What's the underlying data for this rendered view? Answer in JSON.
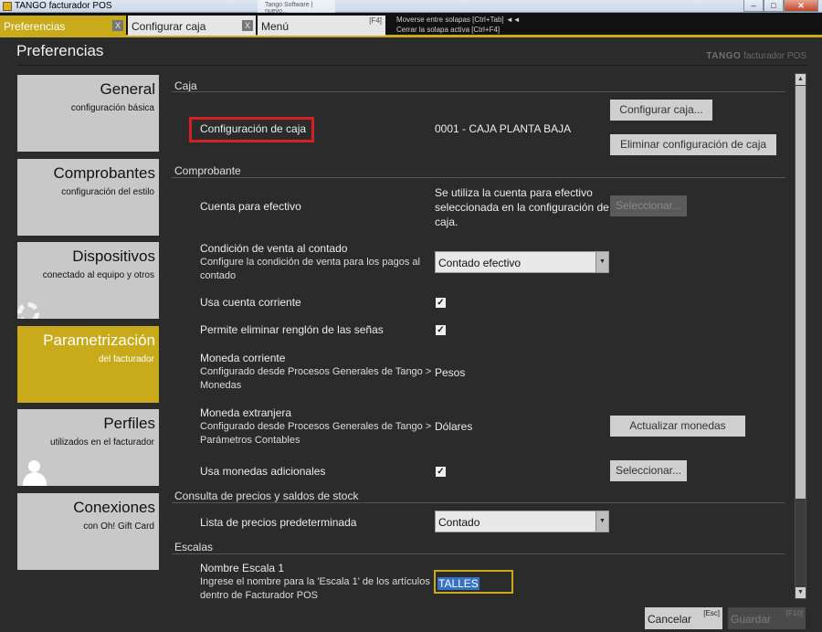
{
  "window": {
    "title": "TANGO facturador POS",
    "ghost_tab": "Tango Software | nuevo..."
  },
  "tabs": [
    {
      "label": "Preferencias",
      "close": "X"
    },
    {
      "label": "Configurar caja",
      "close": "X"
    },
    {
      "label": "Menú",
      "key": "[F4]"
    }
  ],
  "hints": {
    "line1": "Moverse entre solapas [Ctrl+Tab] ◄◄",
    "line2": "Cerrar la solapa activa [Ctrl+F4]"
  },
  "header": {
    "title": "Preferencias",
    "brand_bold": "TANGO",
    "brand_rest": " facturador POS"
  },
  "sidebar": [
    {
      "title": "General",
      "subtitle": "configuración básica"
    },
    {
      "title": "Comprobantes",
      "subtitle": "configuración del estilo"
    },
    {
      "title": "Dispositivos",
      "subtitle": "conectado al equipo y otros"
    },
    {
      "title": "Parametrización",
      "subtitle": "del facturador"
    },
    {
      "title": "Perfiles",
      "subtitle": "utilizados en el facturador"
    },
    {
      "title": "Conexiones",
      "subtitle": "con Oh! Gift Card"
    }
  ],
  "caja": {
    "section": "Caja",
    "label": "Configuración de caja",
    "value": "0001 - CAJA PLANTA BAJA",
    "btn_configurar": "Configurar caja...",
    "btn_eliminar": "Eliminar configuración de caja"
  },
  "comprobante": {
    "section": "Comprobante",
    "cuenta_label": "Cuenta para efectivo",
    "cuenta_info": [
      "Se utiliza la cuenta para efectivo",
      "seleccionada en la configuración de",
      "caja."
    ],
    "btn_seleccionar": "Seleccionar...",
    "condicion_label": "Condición de venta al contado",
    "condicion_sub": [
      "Configure la condición de venta para los pagos al",
      "contado"
    ],
    "condicion_value": "Contado efectivo",
    "cuenta_corriente_label": "Usa cuenta corriente",
    "eliminar_renglon_label": "Permite eliminar renglón de las señas",
    "moneda_corriente_label": "Moneda corriente",
    "moneda_corriente_sub": [
      "Configurado desde Procesos Generales de Tango >",
      "Monedas"
    ],
    "moneda_corriente_value": "Pesos",
    "moneda_extranjera_label": "Moneda extranjera",
    "moneda_extranjera_sub": [
      "Configurado desde Procesos Generales de Tango >",
      "Parámetros Contables"
    ],
    "moneda_extranjera_value": "Dólares",
    "btn_actualizar": "Actualizar monedas",
    "monedas_adicionales_label": "Usa monedas adicionales",
    "btn_seleccionar2": "Seleccionar...",
    "check_mark": "✓"
  },
  "consulta": {
    "section": "Consulta de precios y saldos de stock",
    "lista_label": "Lista de precios predeterminada",
    "lista_value": "Contado"
  },
  "escalas": {
    "section": "Escalas",
    "nombre_label": "Nombre Escala 1",
    "nombre_sub": [
      "Ingrese el nombre para la 'Escala 1' de los artículos",
      "dentro de Facturador POS"
    ],
    "nombre_value": "TALLES"
  },
  "footer": {
    "cancel_label": "Cancelar",
    "cancel_key": "[Esc]",
    "save_label": "Guardar",
    "save_key": "[F10]"
  },
  "colors": {
    "accent": "#c8aa1a",
    "background": "#2b2b2b",
    "highlight": "#d32020"
  }
}
